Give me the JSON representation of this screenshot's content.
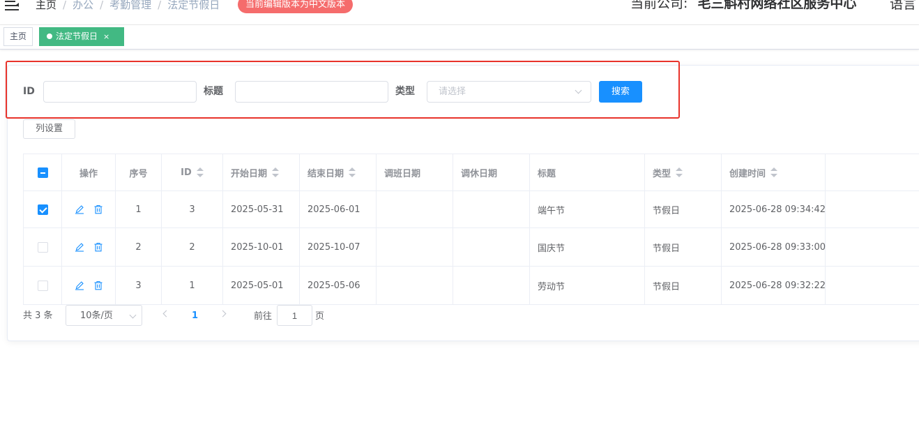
{
  "header": {
    "breadcrumb": [
      "主页",
      "办公",
      "考勤管理",
      "法定节假日"
    ],
    "version_badge": "当前编辑版本为中文版本",
    "company_label": "当前公司:",
    "company_name": "毛三斛村网络社区服务中心",
    "language_label": "语言"
  },
  "tags": {
    "home": "主页",
    "active": "法定节假日",
    "close_symbol": "×"
  },
  "search": {
    "id_label": "ID",
    "id_value": "",
    "title_label": "标题",
    "title_value": "",
    "type_label": "类型",
    "type_placeholder": "请选择",
    "search_button": "搜索"
  },
  "toolbar": {
    "column_settings": "列设置"
  },
  "table": {
    "headers": {
      "ops": "操作",
      "seq": "序号",
      "id": "ID",
      "start": "开始日期",
      "end": "结束日期",
      "adjust_work": "调班日期",
      "adjust_rest": "调休日期",
      "title": "标题",
      "type": "类型",
      "created": "创建时间"
    },
    "rows": [
      {
        "checked": true,
        "seq": "1",
        "id": "3",
        "start": "2025-05-31",
        "end": "2025-06-01",
        "adjust_work": "",
        "adjust_rest": "",
        "title": "端午节",
        "type": "节假日",
        "created": "2025-06-28 09:34:42"
      },
      {
        "checked": false,
        "seq": "2",
        "id": "2",
        "start": "2025-10-01",
        "end": "2025-10-07",
        "adjust_work": "",
        "adjust_rest": "",
        "title": "国庆节",
        "type": "节假日",
        "created": "2025-06-28 09:33:00"
      },
      {
        "checked": false,
        "seq": "3",
        "id": "1",
        "start": "2025-05-01",
        "end": "2025-05-06",
        "adjust_work": "",
        "adjust_rest": "",
        "title": "劳动节",
        "type": "节假日",
        "created": "2025-06-28 09:32:22"
      }
    ]
  },
  "pagination": {
    "total": "共 3 条",
    "page_size": "10条/页",
    "current_page": "1",
    "goto_label": "前往",
    "goto_value": "1",
    "page_unit": "页"
  },
  "colors": {
    "primary": "#1890ff",
    "tag_active": "#42b983",
    "badge_red": "#f56c6c",
    "highlight_frame": "#e8332b"
  },
  "icons": {
    "menu": "hamburger-icon",
    "edit": "edit-icon",
    "delete": "delete-icon"
  }
}
